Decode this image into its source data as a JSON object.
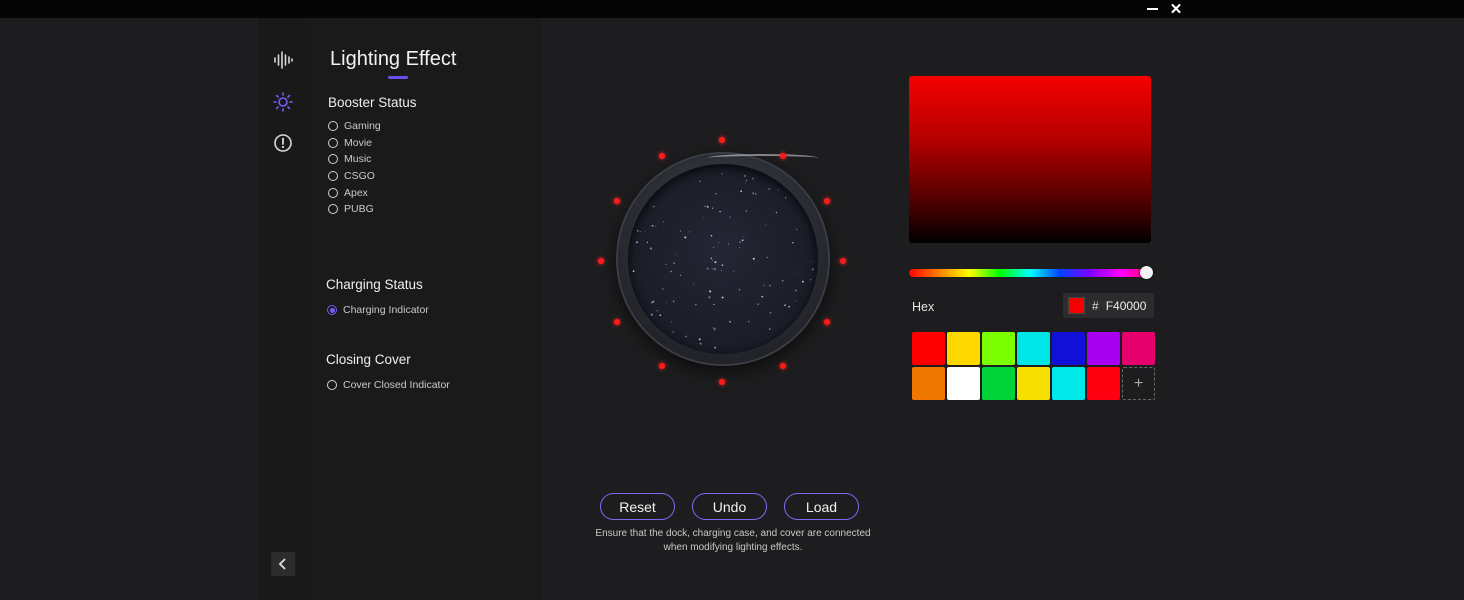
{
  "window": {
    "minimize_icon": "minimize-icon",
    "close_glyph": "✕"
  },
  "rail": {
    "items": [
      {
        "name": "sound-wave-icon"
      },
      {
        "name": "lighting-sun-icon",
        "active": true
      },
      {
        "name": "info-circle-icon"
      }
    ],
    "back_icon": "chevron-left-icon"
  },
  "panel": {
    "title": "Lighting Effect",
    "booster": {
      "title": "Booster Status",
      "options": [
        "Gaming",
        "Movie",
        "Music",
        "CSGO",
        "Apex",
        "PUBG"
      ]
    },
    "charging": {
      "title": "Charging Status",
      "options": [
        {
          "label": "Charging Indicator",
          "selected": true
        }
      ]
    },
    "cover": {
      "title": "Closing Cover",
      "options": [
        {
          "label": "Cover Closed Indicator",
          "selected": false
        }
      ]
    }
  },
  "picker": {
    "hex_label": "Hex",
    "hex_hash": "#",
    "hex_value": "F40000",
    "current_color": "#f40000",
    "hue_position": 0.98,
    "swatches_row1": [
      "#ff0000",
      "#ffd800",
      "#7cff00",
      "#00e5e5",
      "#1010d8",
      "#a800f0",
      "#e5006e"
    ],
    "swatches_row2": [
      "#f07800",
      "#ffffff",
      "#00d23a",
      "#f5e000",
      "#00e8e8",
      "#ff0010"
    ],
    "add_glyph": "+"
  },
  "actions": {
    "reset": "Reset",
    "undo": "Undo",
    "load": "Load",
    "note_line1": "Ensure that the dock, charging case, and cover are connected",
    "note_line2": "when modifying lighting effects."
  },
  "colors": {
    "accent": "#7a5cf5",
    "led": "#ff1a1a"
  }
}
